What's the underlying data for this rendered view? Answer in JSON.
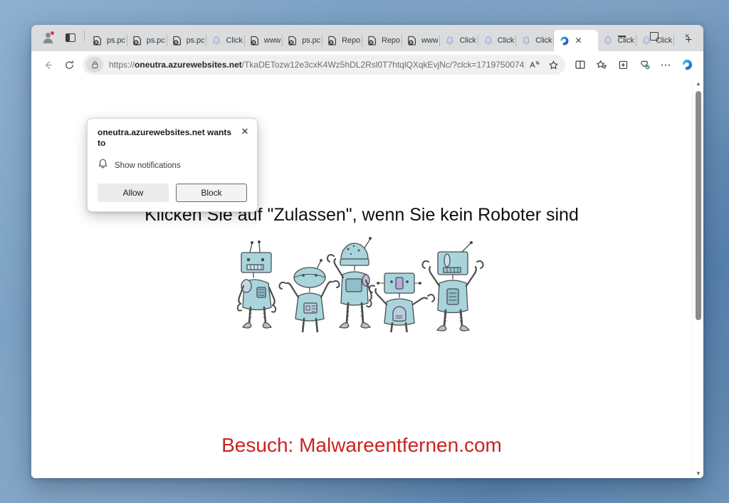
{
  "browser": {
    "name": "Microsoft Edge",
    "profile": {
      "icon": "profile-avatar-icon",
      "badge": "1"
    },
    "tab_actions_icon": "tab-actions-icon",
    "tabs": [
      {
        "label": "ps.pc",
        "favicon": "blocked-page-icon",
        "active": false
      },
      {
        "label": "ps.pc",
        "favicon": "blocked-page-icon",
        "active": false
      },
      {
        "label": "ps.pc",
        "favicon": "blocked-page-icon",
        "active": false
      },
      {
        "label": "Click",
        "favicon": "bell-icon",
        "active": false
      },
      {
        "label": "www",
        "favicon": "blocked-page-icon",
        "active": false
      },
      {
        "label": "ps.pc",
        "favicon": "blocked-page-icon",
        "active": false
      },
      {
        "label": "Repo",
        "favicon": "blocked-page-icon",
        "active": false
      },
      {
        "label": "Repo",
        "favicon": "blocked-page-icon",
        "active": false
      },
      {
        "label": "www",
        "favicon": "blocked-page-icon",
        "active": false
      },
      {
        "label": "Click",
        "favicon": "bell-icon",
        "active": false
      },
      {
        "label": "Click",
        "favicon": "bell-icon",
        "active": false
      },
      {
        "label": "Click",
        "favicon": "bell-icon",
        "active": false
      },
      {
        "label": "",
        "favicon": "edge-logo-icon",
        "active": true
      },
      {
        "label": "Click",
        "favicon": "bell-icon",
        "active": false
      },
      {
        "label": "Click",
        "favicon": "bell-icon",
        "active": false
      }
    ],
    "new_tab_label": "+",
    "window_controls": {
      "minimize": "minimize-button",
      "maximize": "maximize-button",
      "close": "×"
    },
    "toolbar": {
      "back": "←",
      "forward": "→",
      "reload": "↻",
      "url_scheme": "https://",
      "url_host": "oneutra.azurewebsites.net",
      "url_path": "/TkaDETozw12e3cxK4Wz5hDL2Rsl0T7htqlQXqkEvjNc/?clck=171975007410000...",
      "read_aloud": "A",
      "favorite": "☆",
      "split_screen": "split-screen-icon",
      "collections": "collections-icon",
      "browser_essentials": "browser-essentials-icon",
      "settings_more": "⋯",
      "copilot": "copilot-icon"
    }
  },
  "dialog": {
    "title": "oneutra.azurewebsites.net wants to",
    "close": "✕",
    "permission_icon": "bell-icon",
    "permission_label": "Show notifications",
    "allow_label": "Allow",
    "block_label": "Block"
  },
  "page": {
    "heading": "Klicken Sie auf \"Zulassen\", wenn Sie kein Roboter sind",
    "image_alt": "five-cartoon-robots",
    "footer": "Besuch: Malwareentfernen.com",
    "footer_color": "#cc2222"
  },
  "scrollbar": {
    "up_arrow": "▲",
    "down_arrow": "▼"
  }
}
